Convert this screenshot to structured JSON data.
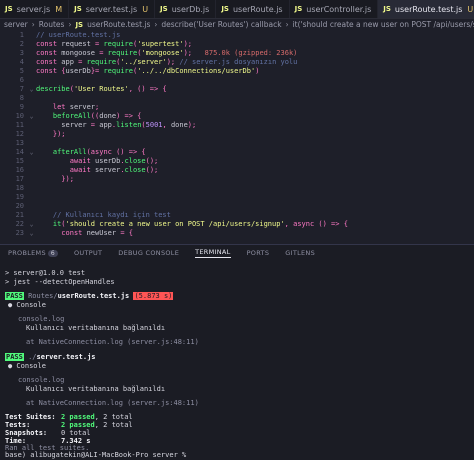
{
  "tabs": [
    {
      "label": "server.js",
      "badge": "M",
      "active": false
    },
    {
      "label": "server.test.js",
      "badge": "U",
      "active": false
    },
    {
      "label": "userDb.js",
      "badge": "",
      "active": false
    },
    {
      "label": "userRoute.js",
      "badge": "",
      "active": false
    },
    {
      "label": "userController.js",
      "badge": "",
      "active": false
    },
    {
      "label": "userRoute.test.js",
      "badge": "U",
      "active": true,
      "close": "✕"
    }
  ],
  "breadcrumb": {
    "folder": "server",
    "sep": "›",
    "routes": "Routes",
    "file": "userRoute.test.js",
    "describe": "describe('User Routes') callback",
    "it": "it('should create a new user on POST /api/users/signup') callback"
  },
  "editor": {
    "lines": [
      {
        "n": "1",
        "fold": "",
        "code": "// userRoute.test.js"
      },
      {
        "n": "2",
        "fold": "",
        "code": "const request = require('supertest');"
      },
      {
        "n": "3",
        "fold": "",
        "code": "const mongoose = require('mongoose');",
        "size": "875.0k (gzipped: 236k)"
      },
      {
        "n": "4",
        "fold": "",
        "code": "const app = require('../server'); ",
        "comment": "// server.js dosyanızın yolu"
      },
      {
        "n": "5",
        "fold": "",
        "code": "const {userDb}= require('../../dbConnections/userDb')"
      },
      {
        "n": "6",
        "fold": "",
        "code": ""
      },
      {
        "n": "7",
        "fold": "⌄",
        "code": "describe('User Routes', () => {"
      },
      {
        "n": "8",
        "fold": "",
        "code": ""
      },
      {
        "n": "9",
        "fold": "",
        "code": "    let server;"
      },
      {
        "n": "10",
        "fold": "⌄",
        "code": "    beforeAll((done) => {"
      },
      {
        "n": "11",
        "fold": "",
        "code": "      server = app.listen(5001, done);"
      },
      {
        "n": "12",
        "fold": "",
        "code": "    });"
      },
      {
        "n": "13",
        "fold": "",
        "code": ""
      },
      {
        "n": "14",
        "fold": "⌄",
        "code": "    afterAll(async () => {"
      },
      {
        "n": "15",
        "fold": "",
        "code": "        await userDb.close();"
      },
      {
        "n": "16",
        "fold": "",
        "code": "        await server.close();"
      },
      {
        "n": "17",
        "fold": "",
        "code": "      });"
      },
      {
        "n": "18",
        "fold": "",
        "code": ""
      },
      {
        "n": "19",
        "fold": "",
        "code": ""
      },
      {
        "n": "20",
        "fold": "",
        "code": ""
      },
      {
        "n": "21",
        "fold": "",
        "code": "    // Kullanıcı kaydı için test"
      },
      {
        "n": "22",
        "fold": "⌄",
        "code": "    it('should create a new user on POST /api/users/signup', async () => {"
      },
      {
        "n": "23",
        "fold": "⌄",
        "code": "      const newUser = {"
      }
    ]
  },
  "panel": {
    "tabs": [
      "PROBLEMS",
      "OUTPUT",
      "DEBUG CONSOLE",
      "TERMINAL",
      "PORTS",
      "GITLENS"
    ],
    "problems_count": "6",
    "active": "TERMINAL"
  },
  "terminal": {
    "l1": "> server@1.0.0 test",
    "l2": "> jest --detectOpenHandles",
    "pass": "PASS",
    "suite1_dir": "Routes/",
    "suite1_file": "userRoute.test.js",
    "suite1_time": "(5.873 s)",
    "console": "● Console",
    "console_log": "console.log",
    "log_msg": "Kullanıcı veritabanına bağlanıldı",
    "at_line": "at NativeConnection.log (server.js:48:11)",
    "suite2_dir": "./",
    "suite2_file": "server.test.js",
    "sum_suites_label": "Test Suites:",
    "sum_suites_passed": "2 passed",
    "sum_suites_total": ", 2 total",
    "sum_tests_label": "Tests:",
    "sum_tests_passed": "2 passed",
    "sum_tests_total": ", 2 total",
    "sum_snap_label": "Snapshots:",
    "sum_snap_val": "0 total",
    "sum_time_label": "Time:",
    "sum_time_val": "7.342 s",
    "ran_all": "Ran all test suites.",
    "prompt": "base) alibugatekin@ALI-MacBook-Pro server %"
  }
}
